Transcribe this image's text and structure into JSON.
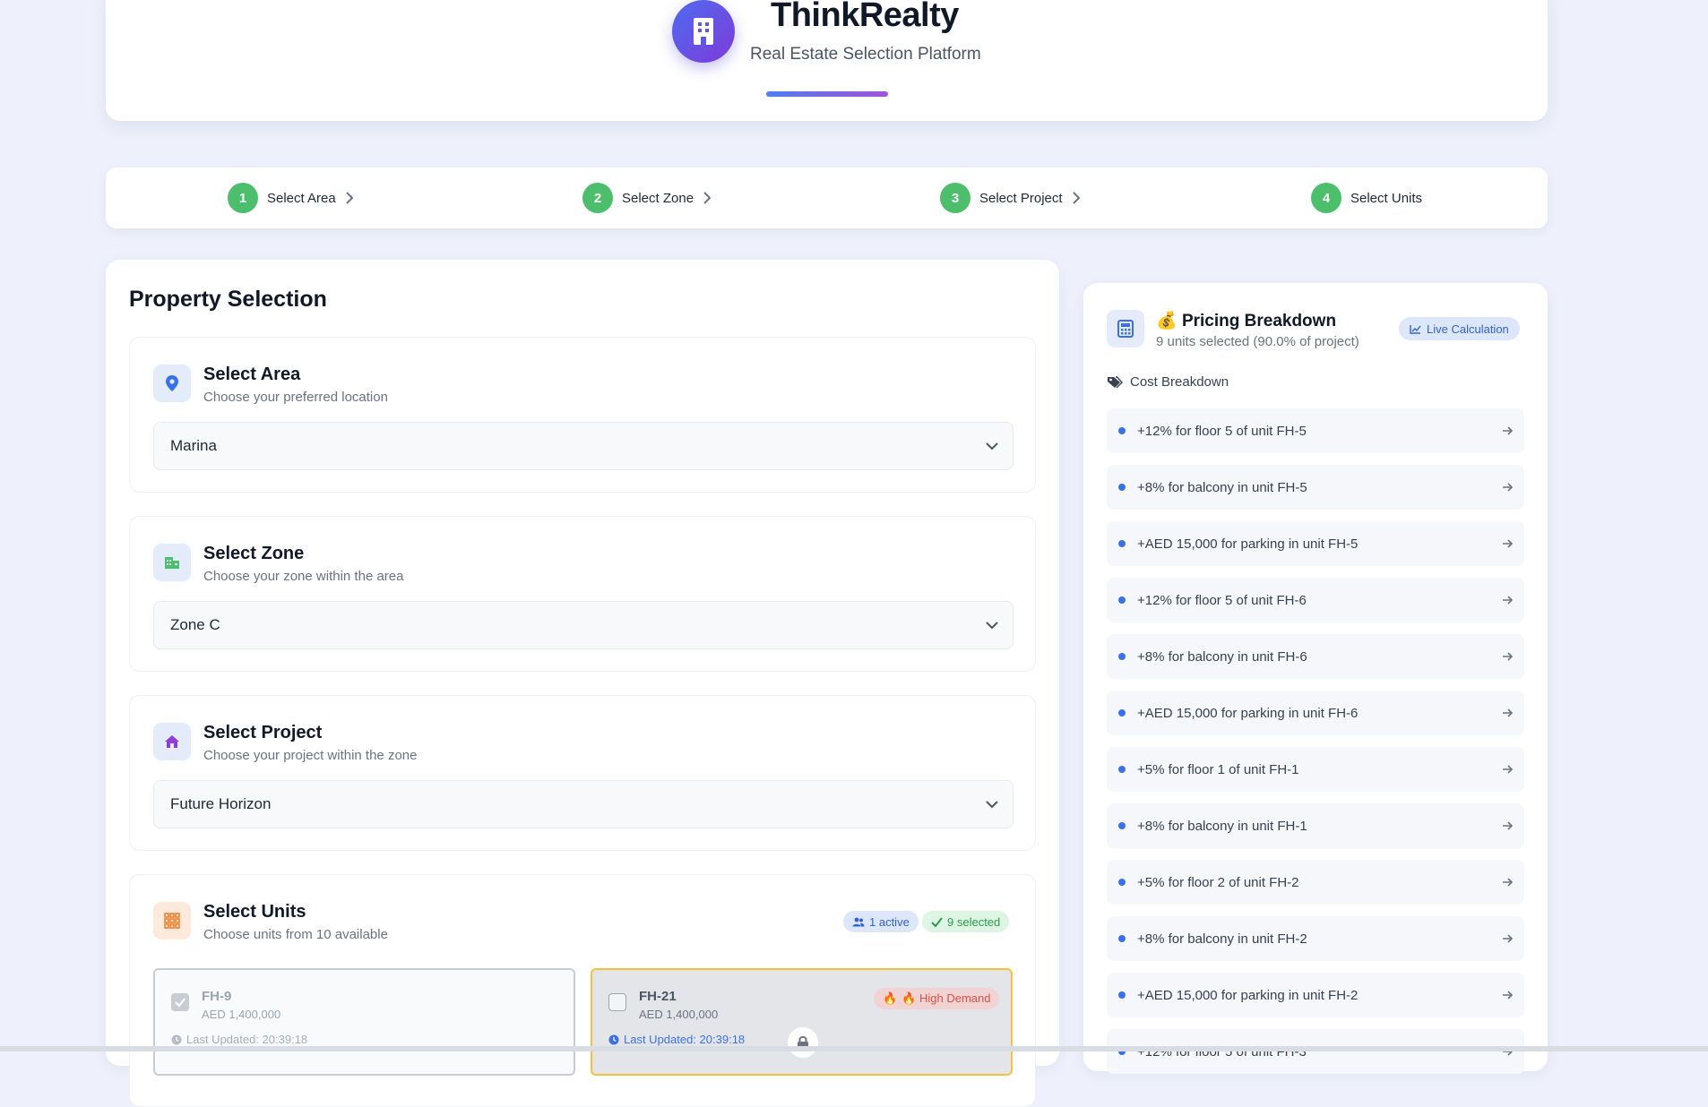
{
  "header": {
    "brand_title": "ThinkRealty",
    "brand_subtitle": "Real Estate Selection Platform",
    "logo_icon": "building-icon"
  },
  "steps": [
    {
      "number": "1",
      "label": "Select Area"
    },
    {
      "number": "2",
      "label": "Select Zone"
    },
    {
      "number": "3",
      "label": "Select Project"
    },
    {
      "number": "4",
      "label": "Select Units"
    }
  ],
  "property_selection": {
    "title": "Property Selection",
    "area": {
      "title": "Select Area",
      "subtitle": "Choose your preferred location",
      "value": "Marina",
      "icon": "map-pin-icon"
    },
    "zone": {
      "title": "Select Zone",
      "subtitle": "Choose your zone within the area",
      "value": "Zone C",
      "icon": "city-icon"
    },
    "project": {
      "title": "Select Project",
      "subtitle": "Choose your project within the zone",
      "value": "Future Horizon",
      "icon": "home-icon"
    },
    "units": {
      "title": "Select Units",
      "subtitle": "Choose units from 10 available",
      "active_badge": "1 active",
      "selected_badge": "9 selected",
      "items": [
        {
          "name": "FH-9",
          "price": "AED 1,400,000",
          "updated": "Last Updated: 20:39:18",
          "checked": true
        },
        {
          "name": "FH-21",
          "price": "AED 1,400,000",
          "updated": "Last Updated: 20:39:18",
          "checked": false,
          "badge": "🔥 High Demand",
          "badge_prefix": "🔥"
        }
      ]
    }
  },
  "pricing": {
    "emoji": "💰",
    "title": "Pricing Breakdown",
    "subtitle": "9 units selected (90.0% of project)",
    "live_badge": "Live Calculation",
    "cost_label": "Cost Breakdown",
    "items": [
      "+12% for floor 5 of unit FH-5",
      "+8% for balcony in unit FH-5",
      "+AED 15,000 for parking in unit FH-5",
      "+12% for floor 5 of unit FH-6",
      "+8% for balcony in unit FH-6",
      "+AED 15,000 for parking in unit FH-6",
      "+5% for floor 1 of unit FH-1",
      "+8% for balcony in unit FH-1",
      "+5% for floor 2 of unit FH-2",
      "+8% for balcony in unit FH-2",
      "+AED 15,000 for parking in unit FH-2",
      "+12% for floor 5 of unit FH-3"
    ]
  },
  "colors": {
    "accent_blue": "#3b71e8",
    "step_green": "#4cbe6c",
    "high_demand_red": "#e25b4b",
    "warning_border": "#f3c340"
  }
}
